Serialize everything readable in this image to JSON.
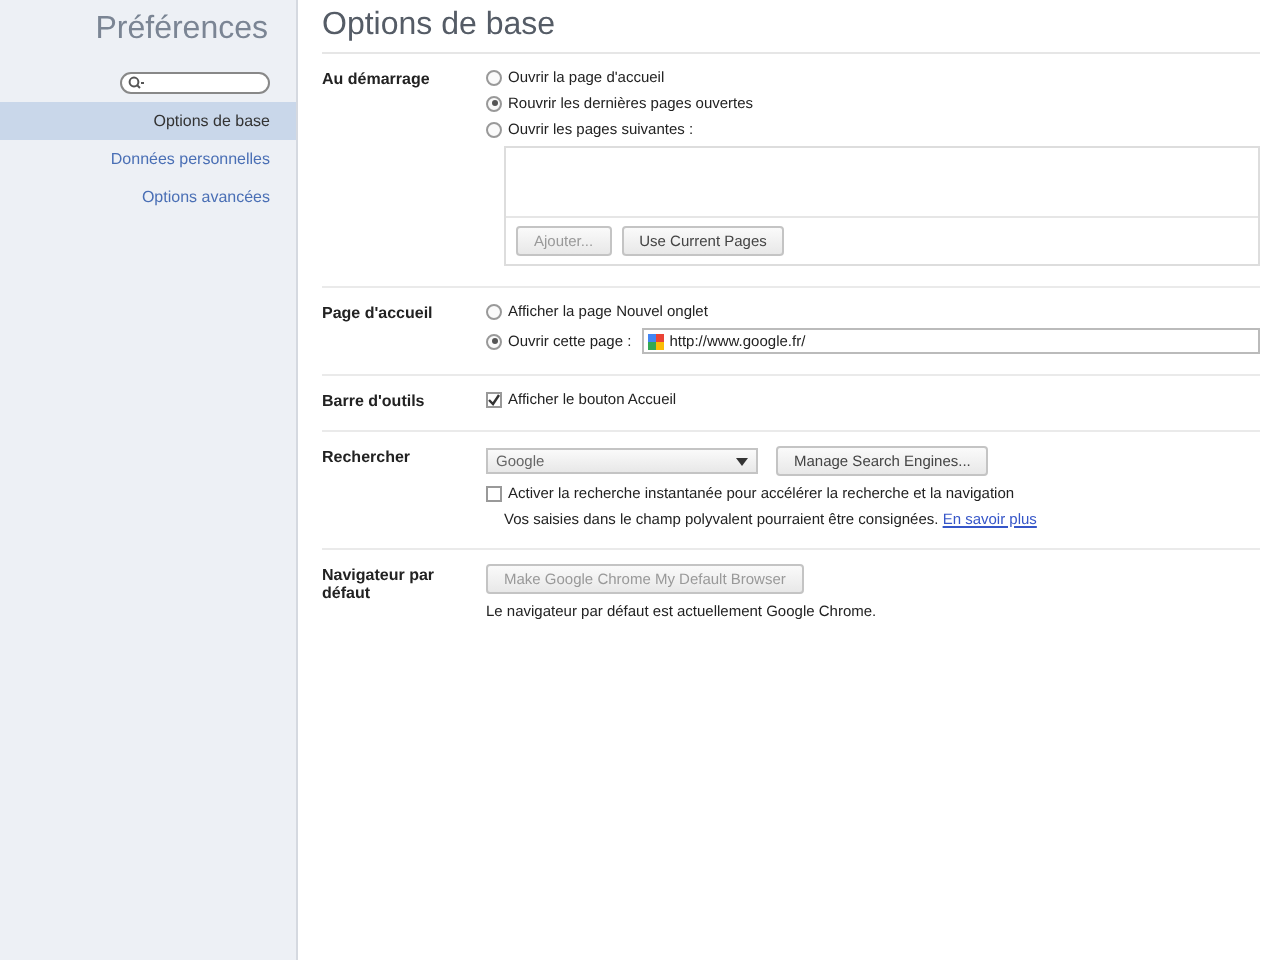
{
  "sidebar": {
    "title": "Préférences",
    "items": [
      {
        "label": "Options de base",
        "selected": true
      },
      {
        "label": "Données personnelles",
        "selected": false
      },
      {
        "label": "Options avancées",
        "selected": false
      }
    ]
  },
  "page": {
    "title": "Options de base"
  },
  "sections": [
    {
      "label": "Au démarrage",
      "controls": [
        {
          "kind": "radio",
          "label": "Ouvrir la page d'accueil",
          "selected": false
        },
        {
          "kind": "radio",
          "label": "Rouvrir les dernières pages ouvertes",
          "selected": true
        },
        {
          "kind": "radio",
          "label": "Ouvrir les pages suivantes :",
          "selected": false
        },
        {
          "kind": "pages_list",
          "buttons": [
            {
              "label": "Ajouter...",
              "disabled": true
            },
            {
              "label": "Use Current Pages",
              "disabled": false
            }
          ]
        }
      ]
    },
    {
      "label": "Page d'accueil",
      "controls": [
        {
          "kind": "radio",
          "label": "Afficher la page Nouvel onglet",
          "selected": false
        },
        {
          "kind": "radio_field",
          "label": "Ouvrir cette page :",
          "selected": true,
          "value": "http://www.google.fr/"
        }
      ]
    },
    {
      "label": "Barre d'outils",
      "controls": [
        {
          "kind": "checkbox",
          "label": "Afficher le bouton Accueil",
          "checked": true
        }
      ]
    },
    {
      "label": "Rechercher",
      "controls": [
        {
          "kind": "select",
          "value": "Google",
          "button": "Manage Search Engines..."
        },
        {
          "kind": "checkbox",
          "label": "Activer la recherche instantanée pour accélérer la recherche et la navigation",
          "checked": false
        },
        {
          "kind": "note",
          "text": "Vos saisies dans le champ polyvalent pourraient être consignées.",
          "link": "En savoir plus"
        }
      ]
    },
    {
      "label": "Navigateur par défaut",
      "controls": [
        {
          "kind": "button",
          "label": "Make Google Chrome My Default Browser",
          "disabled": true
        },
        {
          "kind": "text",
          "text": "Le navigateur par défaut est actuellement Google Chrome."
        }
      ]
    }
  ]
}
